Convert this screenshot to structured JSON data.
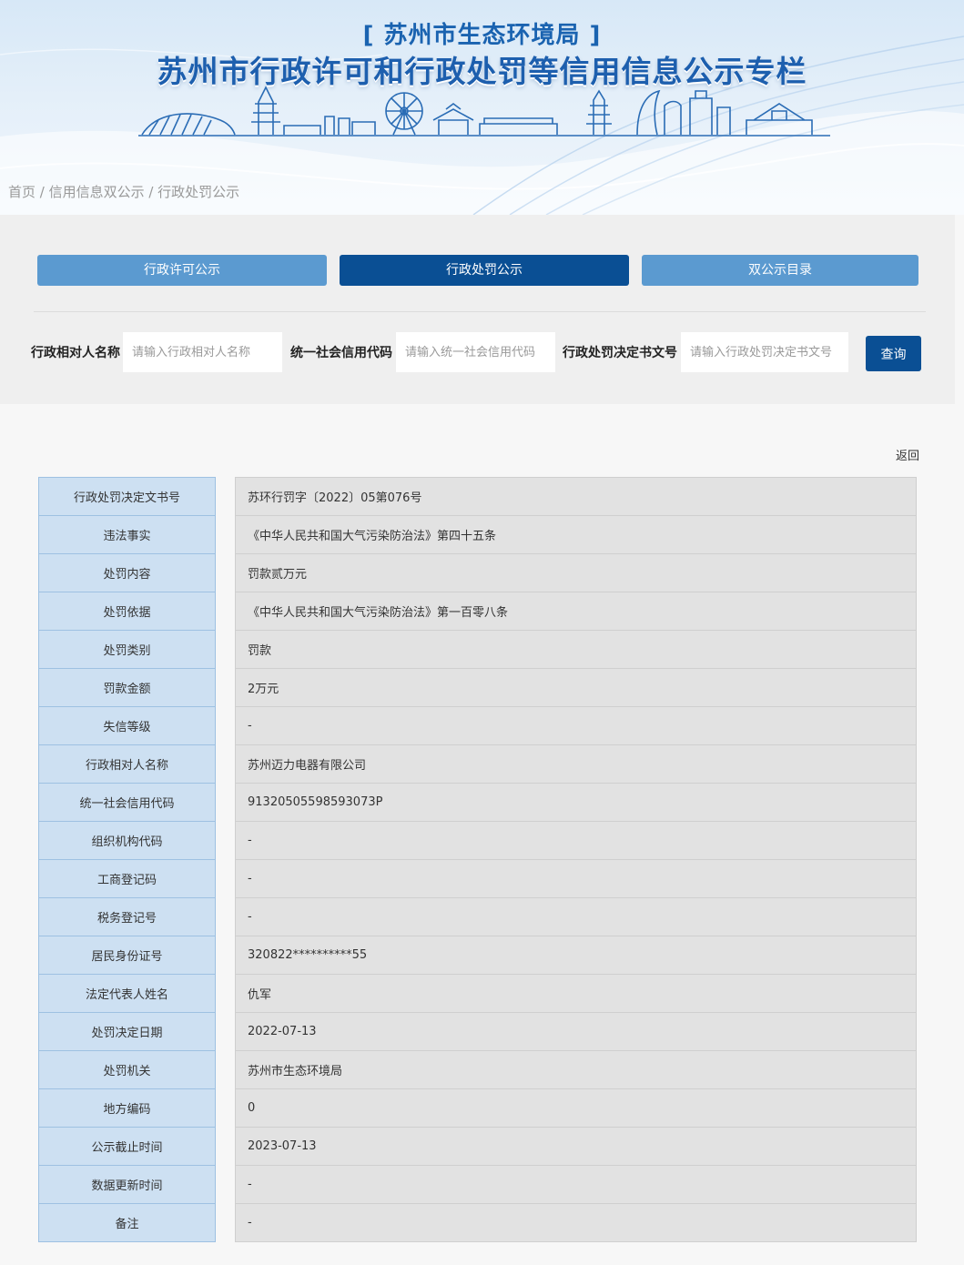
{
  "header": {
    "org_title": "[ 苏州市生态环境局 ]",
    "main_title": "苏州市行政许可和行政处罚等信用信息公示专栏"
  },
  "breadcrumb": "首页 / 信用信息双公示 / 行政处罚公示",
  "tabs": [
    {
      "label": "行政许可公示",
      "active": false
    },
    {
      "label": "行政处罚公示",
      "active": true
    },
    {
      "label": "双公示目录",
      "active": false
    }
  ],
  "search": {
    "fields": [
      {
        "label": "行政相对人名称",
        "placeholder": "请输入行政相对人名称",
        "value": ""
      },
      {
        "label": "统一社会信用代码",
        "placeholder": "请输入统一社会信用代码",
        "value": ""
      },
      {
        "label": "行政处罚决定书文号",
        "placeholder": "请输入行政处罚决定书文号",
        "value": ""
      }
    ],
    "button_label": "查询"
  },
  "back_label": "返回",
  "details": [
    {
      "key": "行政处罚决定文书号",
      "value": "苏环行罚字〔2022〕05第076号"
    },
    {
      "key": "违法事实",
      "value": "《中华人民共和国大气污染防治法》第四十五条"
    },
    {
      "key": "处罚内容",
      "value": "罚款贰万元"
    },
    {
      "key": "处罚依据",
      "value": "《中华人民共和国大气污染防治法》第一百零八条"
    },
    {
      "key": "处罚类别",
      "value": "罚款"
    },
    {
      "key": "罚款金额",
      "value": "2万元"
    },
    {
      "key": "失信等级",
      "value": "-"
    },
    {
      "key": "行政相对人名称",
      "value": "苏州迈力电器有限公司"
    },
    {
      "key": "统一社会信用代码",
      "value": "91320505598593073P"
    },
    {
      "key": "组织机构代码",
      "value": "-"
    },
    {
      "key": "工商登记码",
      "value": "-"
    },
    {
      "key": "税务登记号",
      "value": "-"
    },
    {
      "key": "居民身份证号",
      "value": "320822**********55"
    },
    {
      "key": "法定代表人姓名",
      "value": "仇军"
    },
    {
      "key": "处罚决定日期",
      "value": "2022-07-13"
    },
    {
      "key": "处罚机关",
      "value": "苏州市生态环境局"
    },
    {
      "key": "地方编码",
      "value": "0"
    },
    {
      "key": "公示截止时间",
      "value": "2023-07-13"
    },
    {
      "key": "数据更新时间",
      "value": "-"
    },
    {
      "key": "备注",
      "value": "-"
    }
  ],
  "colors": {
    "tab_active": "#0a4f94",
    "tab_inactive": "#5b9ad0",
    "key_cell_bg": "#cde0f2",
    "value_cell_bg": "#e2e2e2",
    "title_blue": "#1d5fae"
  }
}
